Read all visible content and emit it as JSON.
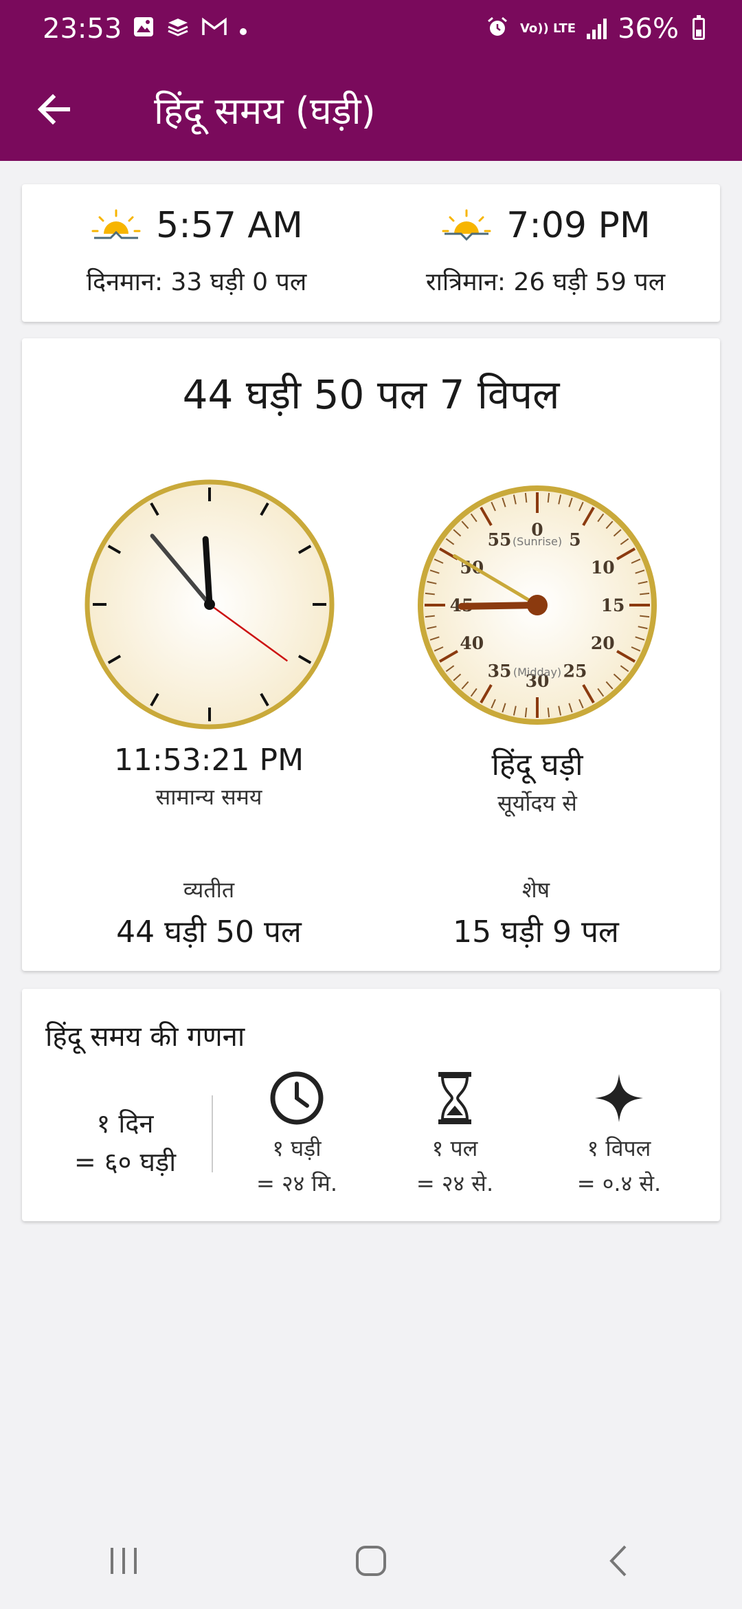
{
  "status_bar": {
    "time": "23:53",
    "volte": "Vo)) LTE",
    "battery": "36%"
  },
  "app_bar": {
    "title": "हिंदू समय (घड़ी)"
  },
  "sun": {
    "sunrise_time": "5:57 AM",
    "sunset_time": "7:09 PM",
    "dinman": "दिनमान: 33 घड़ी 0 पल",
    "ratriman": "रात्रिमान: 26 घड़ी 59 पल",
    "sun_color": "#f7b500"
  },
  "main": {
    "ghadi_time": "44 घड़ी 50 पल 7 विपल",
    "normal_time": "11:53:21 PM",
    "normal_label": "सामान्य समय",
    "hindu_label": "हिंदू घड़ी",
    "hindu_sub": "सूर्योदय से",
    "elapsed_title": "व्यतीत",
    "elapsed_value": "44 घड़ी 50 पल",
    "remaining_title": "शेष",
    "remaining_value": "15 घड़ी 9 पल",
    "ghadi_numbers": [
      "0",
      "5",
      "10",
      "15",
      "20",
      "25",
      "30",
      "35",
      "40",
      "45",
      "50",
      "55"
    ],
    "sunrise_mark": "(Sunrise)",
    "midday_mark": "(Midday)",
    "clock": {
      "hours": 11,
      "minutes": 53,
      "seconds": 21
    },
    "ghadi": {
      "ghadi": 44,
      "pal": 50,
      "vipal": 7
    },
    "accent_gold": "#c9a93a",
    "hand_brown": "#8b3a0f"
  },
  "calc": {
    "title": "हिंदू समय की गणना",
    "day_line1": "१ दिन",
    "day_line2": "= ६० घड़ी",
    "ghadi_line1": "१ घड़ी",
    "ghadi_line2": "= २४ मि.",
    "pal_line1": "१ पल",
    "pal_line2": "= २४ से.",
    "vipal_line1": "१ विपल",
    "vipal_line2": "= ०.४ से."
  }
}
